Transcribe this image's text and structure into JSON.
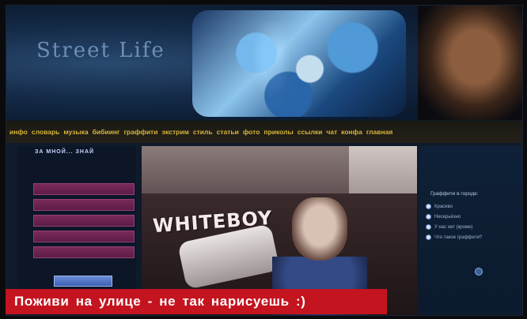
{
  "header": {
    "site_title": "Street Life"
  },
  "nav": {
    "items": [
      "инфо",
      "словарь",
      "музыка",
      "бибиинг",
      "граффити",
      "экстрим",
      "стиль",
      "статьи",
      "фото",
      "приколы",
      "ссылки",
      "чат",
      "конфа",
      "главная"
    ]
  },
  "left_panel": {
    "heading": "ЗА МНОЙ... ЗНАЙ"
  },
  "photo": {
    "wall_text": "WHITEBOY"
  },
  "poll": {
    "title": "Граффити в городе:",
    "options": [
      "Красиво",
      "Несерьёзно",
      "У нас нет (кроме)",
      "Что такое граффити?"
    ]
  },
  "caption": {
    "text": "Поживи на улице - не так нарисуешь :)"
  },
  "colors": {
    "caption_bg": "#c4141f",
    "nav_text": "#d7b53a"
  }
}
